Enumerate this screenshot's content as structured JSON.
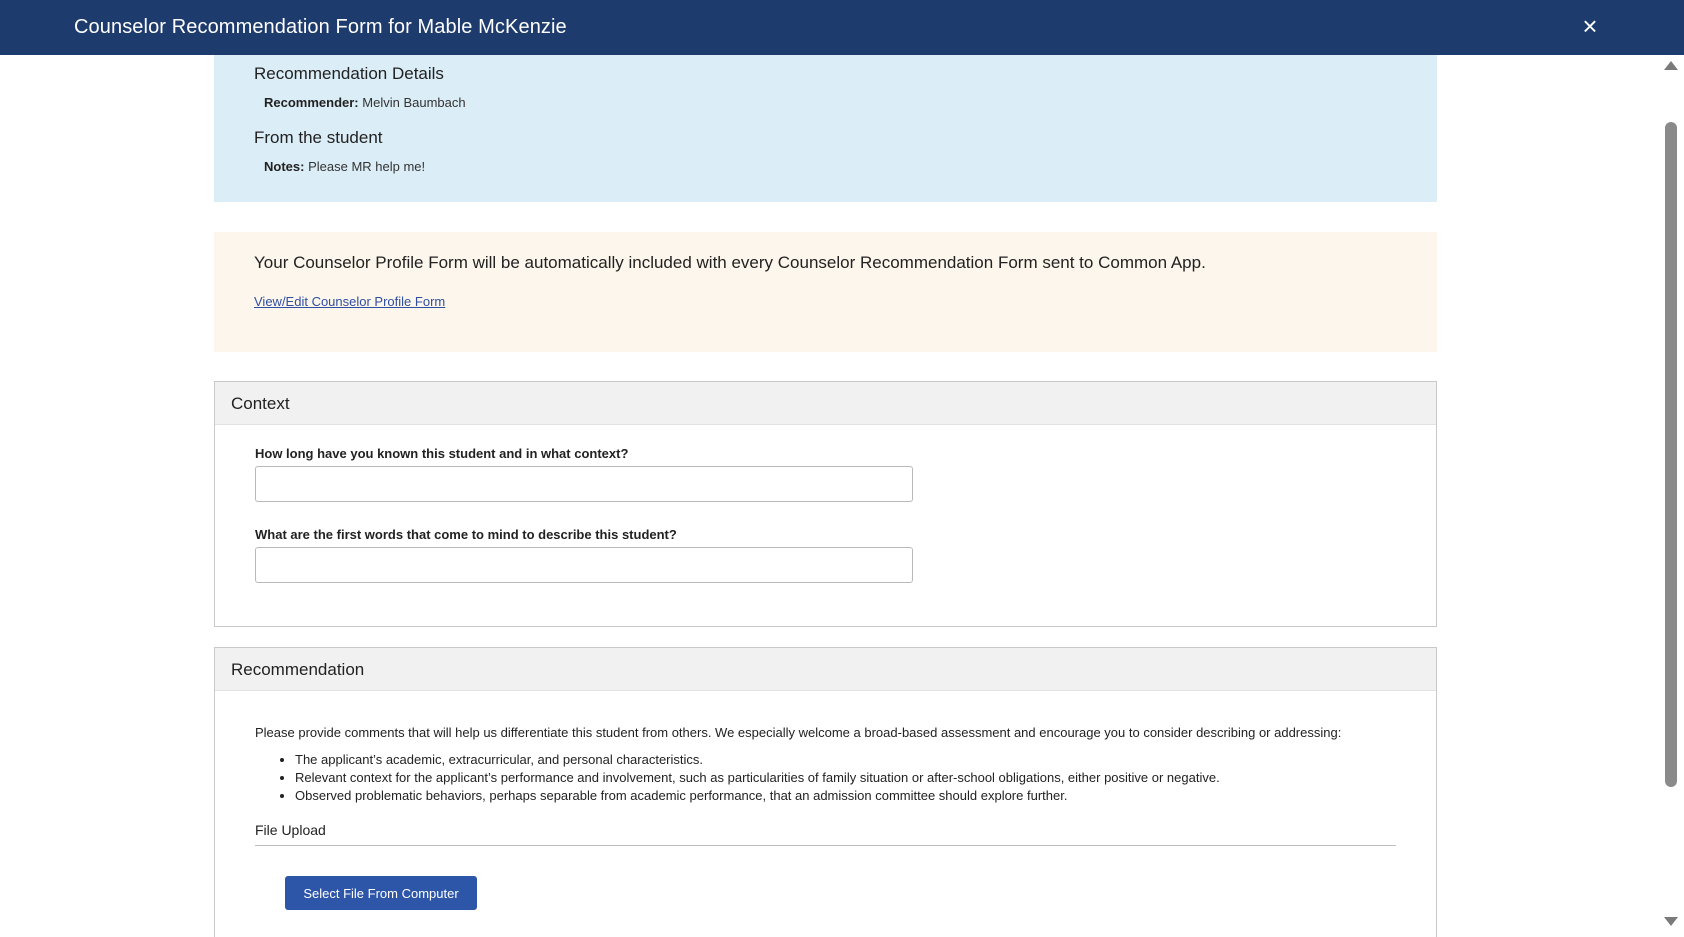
{
  "header": {
    "title": "Counselor Recommendation Form for Mable McKenzie",
    "close_icon": "×"
  },
  "details": {
    "heading": "Recommendation Details",
    "recommender_label": "Recommender:",
    "recommender_value": "Melvin Baumbach",
    "student_heading": "From the student",
    "notes_label": "Notes:",
    "notes_value": "Please MR help me!"
  },
  "notice": {
    "message": "Your Counselor Profile Form will be automatically included with every Counselor Recommendation Form sent to Common App.",
    "link": "View/Edit Counselor Profile Form"
  },
  "context": {
    "title": "Context",
    "q1_label": "How long have you known this student and in what context?",
    "q1_value": "",
    "q2_label": "What are the first words that come to mind to describe this student?",
    "q2_value": ""
  },
  "recommendation": {
    "title": "Recommendation",
    "intro": "Please provide comments that will help us differentiate this student from others. We especially welcome a broad-based assessment and encourage you to consider describing or addressing:",
    "bullets": [
      "The applicant’s academic, extracurricular, and personal characteristics.",
      "Relevant context for the applicant’s performance and involvement, such as particularities of family situation or after-school obligations, either positive or negative.",
      "Observed problematic behaviors, perhaps separable from academic performance, that an admission committee should explore further."
    ],
    "file_upload_label": "File Upload",
    "upload_button": "Select File From Computer"
  },
  "colors": {
    "header_bg": "#1d3b6d",
    "details_bg": "#dbedf6",
    "notice_bg": "#fdf6ec",
    "button_bg": "#2d56a8"
  },
  "icons": {
    "close": "close-icon",
    "scroll_up": "scroll-up-arrow-icon",
    "scroll_down": "scroll-down-arrow-icon"
  }
}
